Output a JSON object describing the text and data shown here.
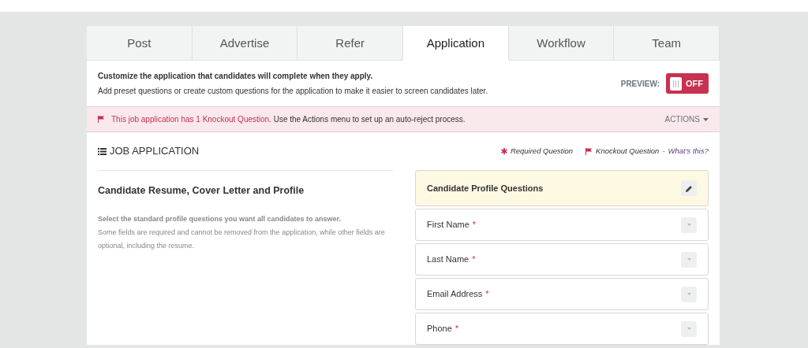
{
  "tabs": [
    {
      "label": "Post",
      "selected": false
    },
    {
      "label": "Advertise",
      "selected": false
    },
    {
      "label": "Refer",
      "selected": false
    },
    {
      "label": "Application",
      "selected": true
    },
    {
      "label": "Workflow",
      "selected": false
    },
    {
      "label": "Team",
      "selected": false
    }
  ],
  "intro": {
    "title": "Customize the application that candidates will complete when they apply.",
    "text": "Add preset questions or create custom questions for the application to make it easier to screen candidates later."
  },
  "preview": {
    "label": "PREVIEW:",
    "on": false,
    "state_text": "OFF"
  },
  "alert": {
    "highlight": "This job application has 1 Knockout Question.",
    "text": "Use the Actions menu to set up an auto-reject process.",
    "actions": "ACTIONS"
  },
  "section": {
    "title": "JOB APPLICATION",
    "legend": [
      {
        "kind": "required",
        "label": "Required Question"
      },
      {
        "kind": "knockout",
        "label": "Knockout Question",
        "separator": "-",
        "link": "What's this?"
      }
    ]
  },
  "left": {
    "title": "Candidate Resume, Cover Letter and Profile",
    "lead": "Select the standard profile questions you want all candidates to answer.",
    "text": "Some fields are required and cannot be removed from the application, while other fields are optional, including the resume."
  },
  "questions": {
    "title": "Candidate Profile Questions",
    "items": [
      {
        "label": "First Name",
        "mark": "*"
      },
      {
        "label": "Last Name",
        "mark": "*"
      },
      {
        "label": "Email Address",
        "mark": "*"
      },
      {
        "label": "Phone",
        "mark": "*"
      }
    ]
  }
}
